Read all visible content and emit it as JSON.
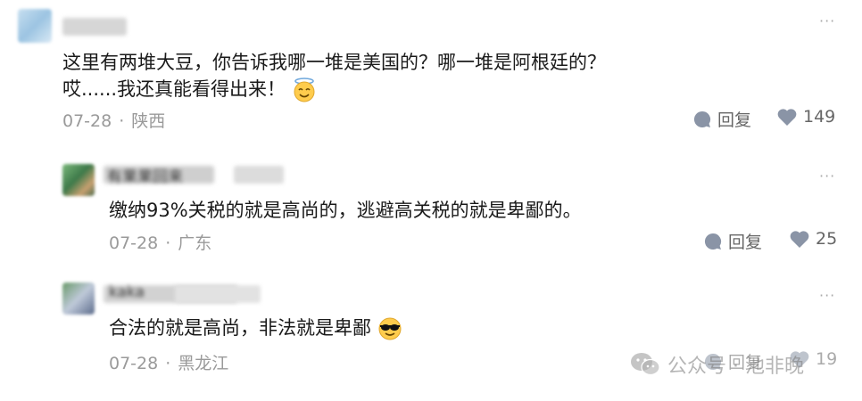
{
  "comments": [
    {
      "text_lines": [
        "这里有两堆大豆，你告诉我哪一堆是美国的？哪一堆是阿根廷的？",
        "哎......我还真能看得出来！"
      ],
      "date": "07-28",
      "location": "陕西",
      "reply_label": "回复",
      "likes": "149",
      "emoji": "smiling-face-with-halo"
    },
    {
      "name_partial": "有果果回来",
      "text": "缴纳93%关税的就是高尚的，逃避高关税的就是卑鄙的。",
      "date": "07-28",
      "location": "广东",
      "reply_label": "回复",
      "likes": "25"
    },
    {
      "name_partial": "kaka",
      "text": "合法的就是高尚，非法就是卑鄙",
      "date": "07-28",
      "location": "黑龙江",
      "reply_label": "回复",
      "likes": "19",
      "emoji": "smiling-face-with-sunglasses"
    }
  ],
  "more_glyph": "···",
  "separator": "·",
  "watermark": {
    "text": "公众号 · 池非晚",
    "icon": "wechat-icon"
  },
  "colors": {
    "text": "#1a1a1a",
    "meta": "#9a9a9a",
    "icon": "#8a94a6",
    "watermark": "#9a9a9a"
  }
}
